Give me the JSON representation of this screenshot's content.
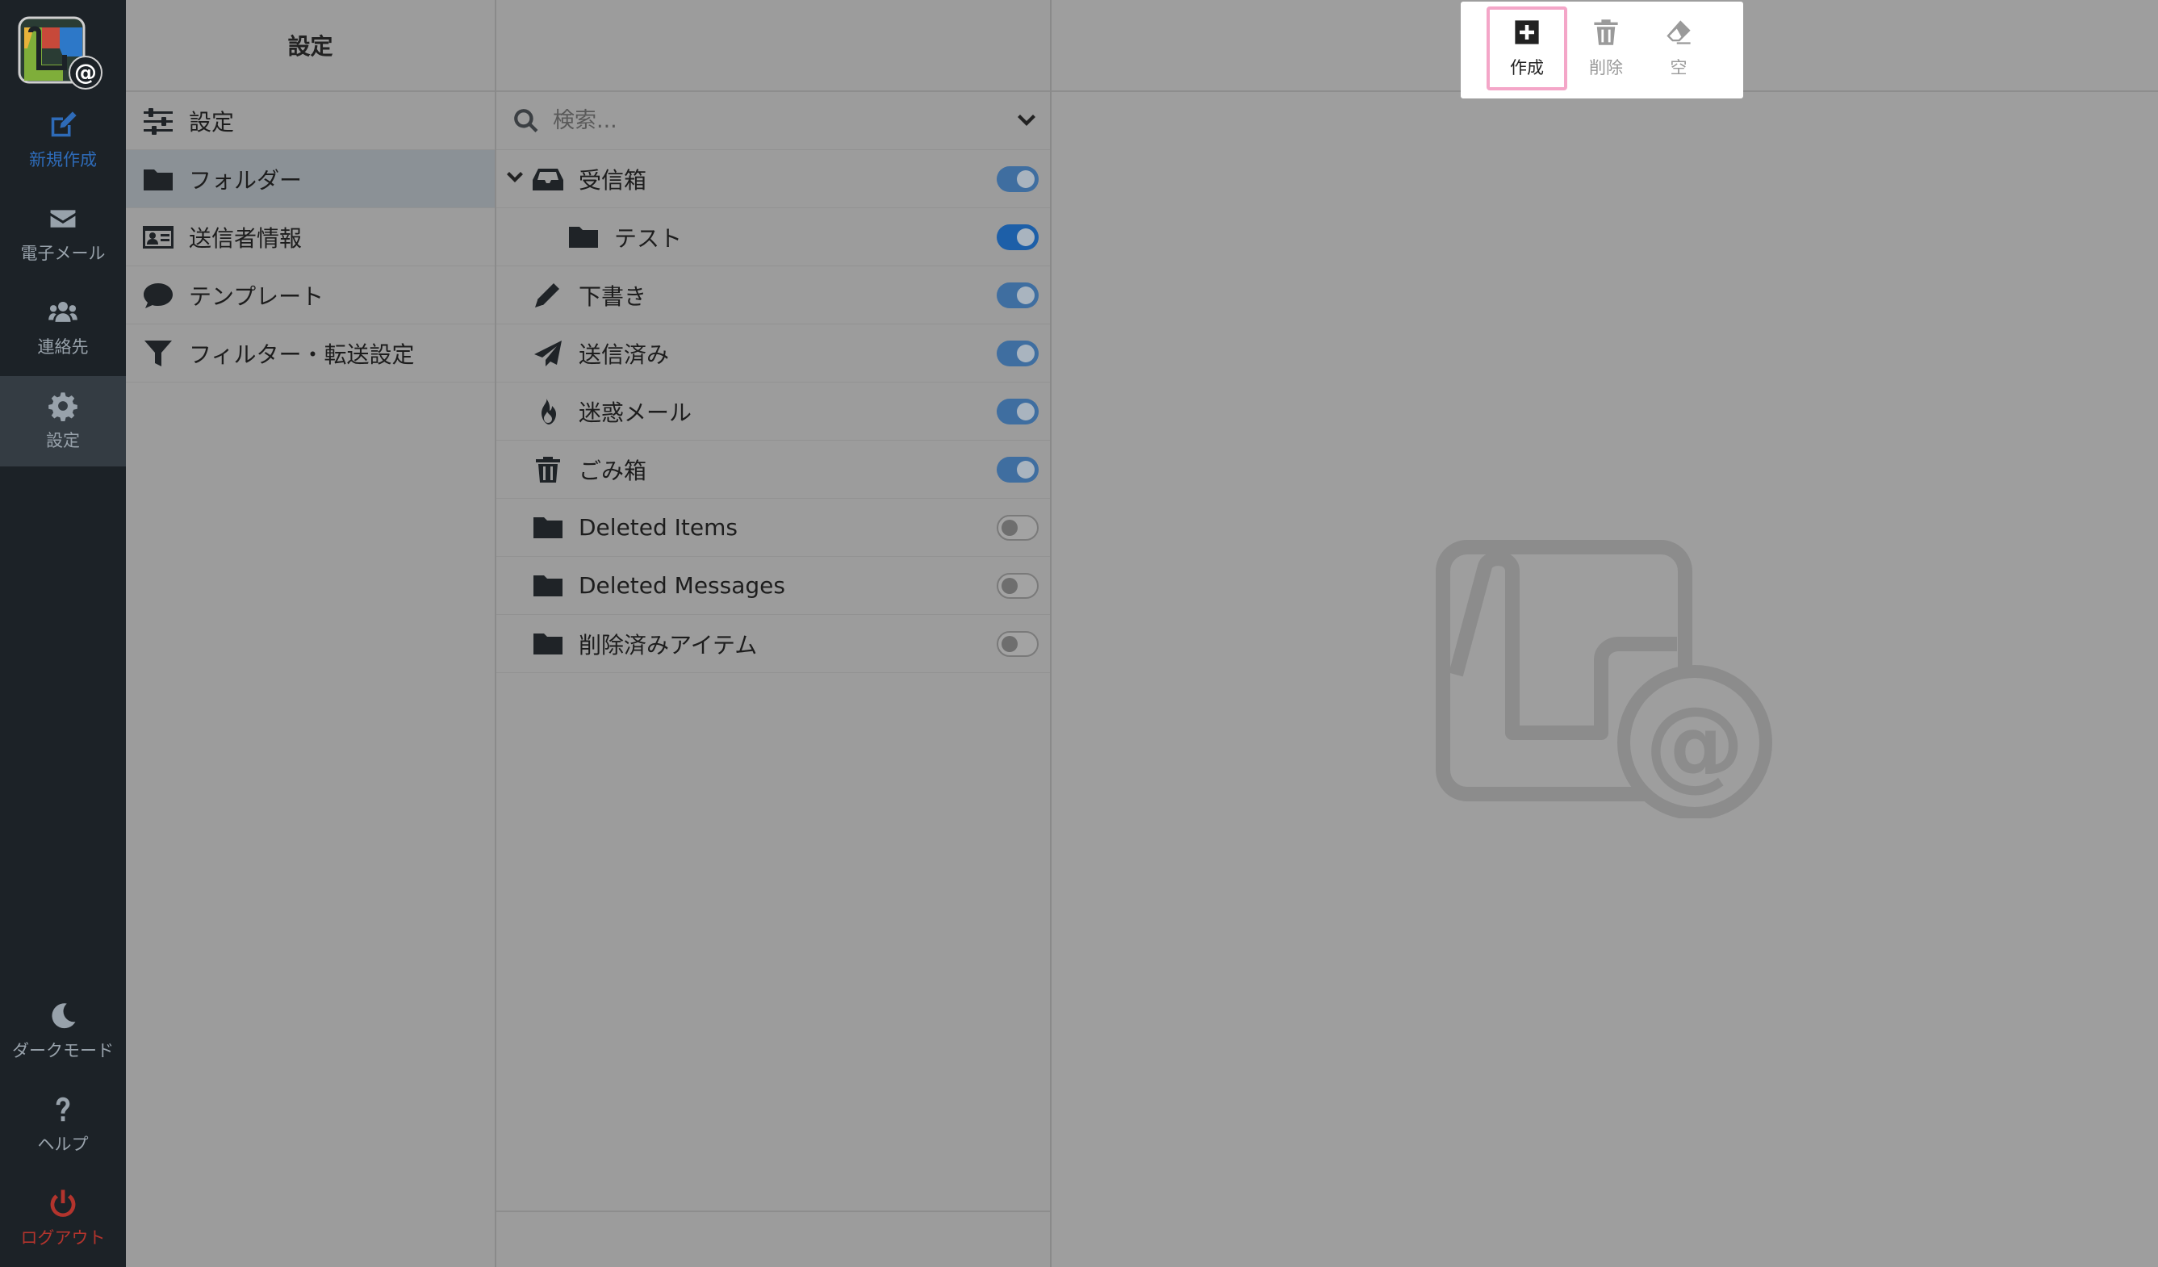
{
  "rail": {
    "items": [
      {
        "label": "新規作成",
        "icon": "compose-icon"
      },
      {
        "label": "電子メール",
        "icon": "envelope-icon"
      },
      {
        "label": "連絡先",
        "icon": "users-icon"
      },
      {
        "label": "設定",
        "icon": "gear-icon"
      }
    ],
    "bottom": [
      {
        "label": "ダークモード",
        "icon": "moon-icon"
      },
      {
        "label": "ヘルプ",
        "icon": "question-icon"
      },
      {
        "label": "ログアウト",
        "icon": "power-icon"
      }
    ]
  },
  "settings": {
    "title": "設定",
    "items": [
      {
        "label": "設定",
        "icon": "sliders-icon"
      },
      {
        "label": "フォルダー",
        "icon": "folder-icon"
      },
      {
        "label": "送信者情報",
        "icon": "id-card-icon"
      },
      {
        "label": "テンプレート",
        "icon": "comment-icon"
      },
      {
        "label": "フィルター・転送設定",
        "icon": "filter-icon"
      }
    ]
  },
  "folders": {
    "search_placeholder": "検索...",
    "items": [
      {
        "label": "受信箱",
        "icon": "inbox-icon",
        "subscribed": true
      },
      {
        "label": "テスト",
        "icon": "folder-icon",
        "subscribed": true
      },
      {
        "label": "下書き",
        "icon": "pencil-icon",
        "subscribed": true
      },
      {
        "label": "送信済み",
        "icon": "paper-plane-icon",
        "subscribed": true
      },
      {
        "label": "迷惑メール",
        "icon": "fire-icon",
        "subscribed": true
      },
      {
        "label": "ごみ箱",
        "icon": "trash-icon",
        "subscribed": true
      },
      {
        "label": "Deleted Items",
        "icon": "folder-icon",
        "subscribed": false
      },
      {
        "label": "Deleted Messages",
        "icon": "folder-icon",
        "subscribed": false
      },
      {
        "label": "削除済みアイテム",
        "icon": "folder-icon",
        "subscribed": false
      }
    ]
  },
  "toolbar": {
    "create_label": "作成",
    "delete_label": "削除",
    "empty_label": "空"
  },
  "colors": {
    "rail_bg": "#1c2227",
    "accent": "#2e6bb8",
    "logout": "#b3342d",
    "highlight": "#f4a6c8"
  }
}
